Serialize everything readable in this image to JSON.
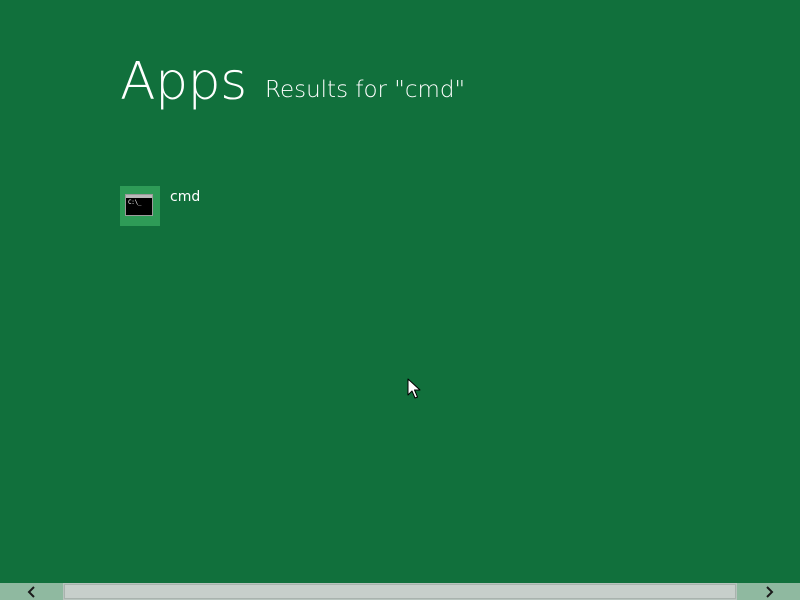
{
  "screen": {
    "title": "Apps",
    "subtitle_prefix": "Results for ",
    "subtitle_query": "\"cmd\""
  },
  "results": [
    {
      "label": "cmd",
      "icon": "command-prompt-icon",
      "icon_text": "C:\\_"
    }
  ],
  "scrollbar": {
    "left_arrow": "‹",
    "right_arrow": "›",
    "position": 0
  },
  "colors": {
    "background": "#11703c",
    "tile": "#2e9b57",
    "scrollbar_button": "#8fb9a0"
  }
}
